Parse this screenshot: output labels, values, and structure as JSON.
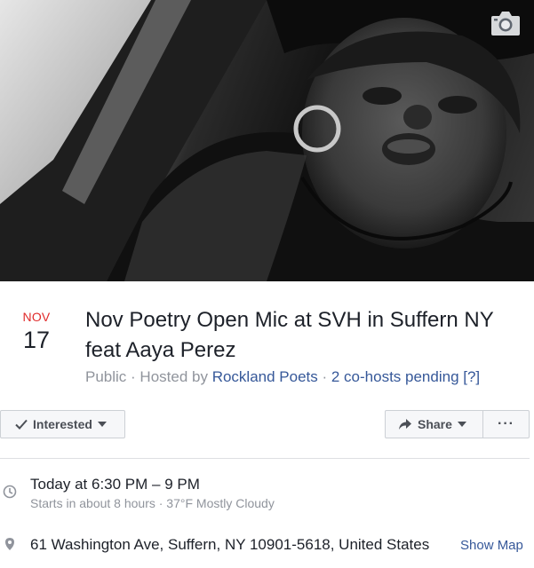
{
  "event": {
    "month": "NOV",
    "day": "17",
    "title": "Nov Poetry Open Mic at SVH in Suffern NY feat Aaya Perez",
    "privacy": "Public",
    "separator": " · ",
    "hosted_by_prefix": "Hosted by ",
    "host_name": "Rockland Poets",
    "cohosts_pending": "2 co-hosts pending [?]"
  },
  "actions": {
    "interested_label": "Interested",
    "share_label": "Share",
    "more_label": "···"
  },
  "details": {
    "time_main": "Today at 6:30 PM – 9 PM",
    "time_sub": "Starts in about 8 hours · 37°F Mostly Cloudy",
    "address": "61 Washington Ave, Suffern, NY 10901-5618, United States",
    "show_map_label": "Show Map"
  },
  "colors": {
    "month_red": "#e02a2a",
    "link_blue": "#365899",
    "muted_gray": "#90949c"
  }
}
